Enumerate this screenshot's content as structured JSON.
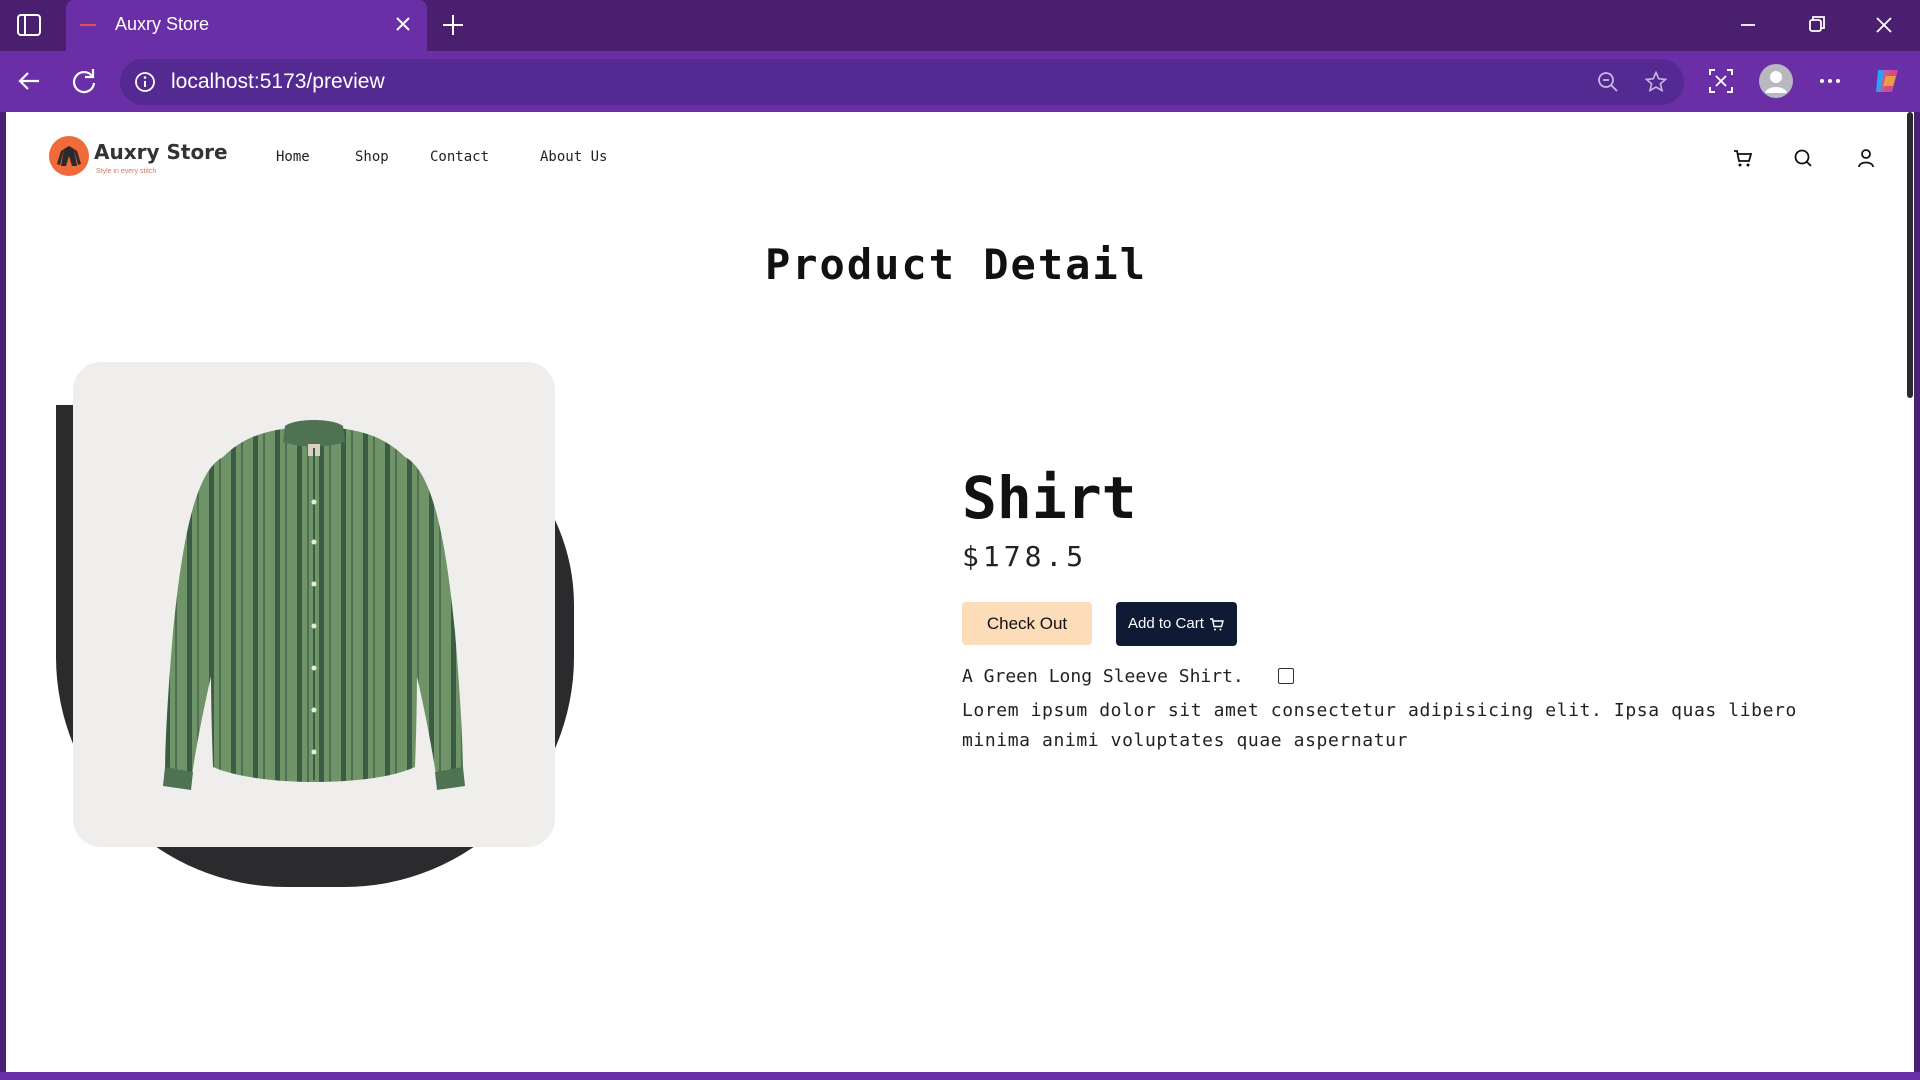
{
  "browser": {
    "tab_title": "Auxry Store",
    "url": "localhost:5173/preview"
  },
  "site": {
    "brand": "Auxry Store",
    "tagline": "Style in every stitch",
    "nav": [
      "Home",
      "Shop",
      "Contact",
      "About Us"
    ]
  },
  "page": {
    "title": "Product Detail"
  },
  "product": {
    "name": "Shirt",
    "price": "$178.5",
    "checkout_label": "Check Out",
    "add_to_cart_label": "Add to Cart",
    "short_description": "A Green Long Sleeve Shirt.",
    "long_description": "Lorem ipsum dolor sit amet consectetur adipisicing elit. Ipsa quas libero minima animi voluptates quae aspernatur",
    "image_alt": "green striped long sleeve shirt"
  },
  "colors": {
    "browser_frame": "#6a2fa6",
    "logo_accent": "#f06a3a",
    "checkout_bg": "#fcdcb9",
    "cart_bg": "#111a35",
    "blob": "#2b2b2e"
  },
  "icons": [
    "cart-icon",
    "search-icon",
    "user-icon"
  ]
}
